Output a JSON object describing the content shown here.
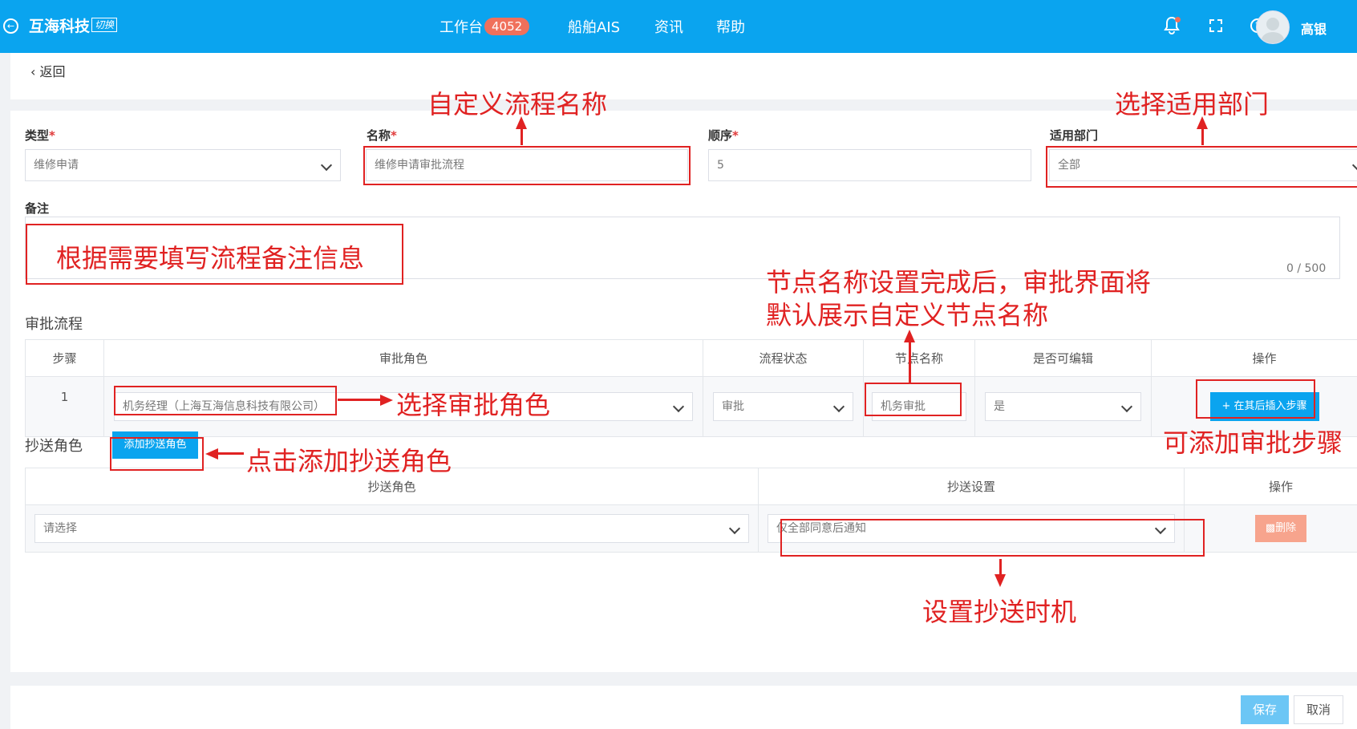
{
  "header": {
    "brand": "互海科技",
    "switch_label": "切换",
    "nav": [
      {
        "label": "工作台",
        "badge": "4052"
      },
      {
        "label": "船舶AIS"
      },
      {
        "label": "资讯"
      },
      {
        "label": "帮助"
      }
    ],
    "icons": [
      "bell-icon",
      "fullscreen-icon",
      "help-icon"
    ],
    "user_name": "高银"
  },
  "back_label": "返回",
  "form": {
    "type": {
      "label": "类型",
      "value": "维修申请"
    },
    "name": {
      "label": "名称",
      "value": "维修申请审批流程"
    },
    "order": {
      "label": "顺序",
      "value": "5"
    },
    "dept": {
      "label": "适用部门",
      "value": "全部"
    },
    "remark": {
      "label": "备注",
      "counter": "0 / 500"
    }
  },
  "approval": {
    "title": "审批流程",
    "columns": [
      "步骤",
      "审批角色",
      "流程状态",
      "节点名称",
      "是否可编辑",
      "操作"
    ],
    "rows": [
      {
        "step": "1",
        "role": "机务经理（上海互海信息科技有限公司）",
        "status": "审批",
        "node_name": "机务审批",
        "editable": "是",
        "action": "+ 在其后插入步骤"
      }
    ]
  },
  "cc": {
    "title": "抄送角色",
    "add_button": "添加抄送角色",
    "columns": [
      "抄送角色",
      "抄送设置",
      "操作"
    ],
    "rows": [
      {
        "role_placeholder": "请选择",
        "setting": "仅全部同意后通知",
        "action": "删除"
      }
    ]
  },
  "footer": {
    "save": "保存",
    "cancel": "取消"
  },
  "annotations": {
    "name": "自定义流程名称",
    "dept": "选择适用部门",
    "remark": "根据需要填写流程备注信息",
    "node_line1": "节点名称设置完成后，审批界面将",
    "node_line2": "默认展示自定义节点名称",
    "role": "选择审批角色",
    "add_step": "可添加审批步骤",
    "add_cc": "点击添加抄送角色",
    "cc_setting": "设置抄送时机"
  },
  "colors": {
    "primary": "#0aa4ef",
    "annotation": "#e02222",
    "delete": "#f7a48d"
  }
}
